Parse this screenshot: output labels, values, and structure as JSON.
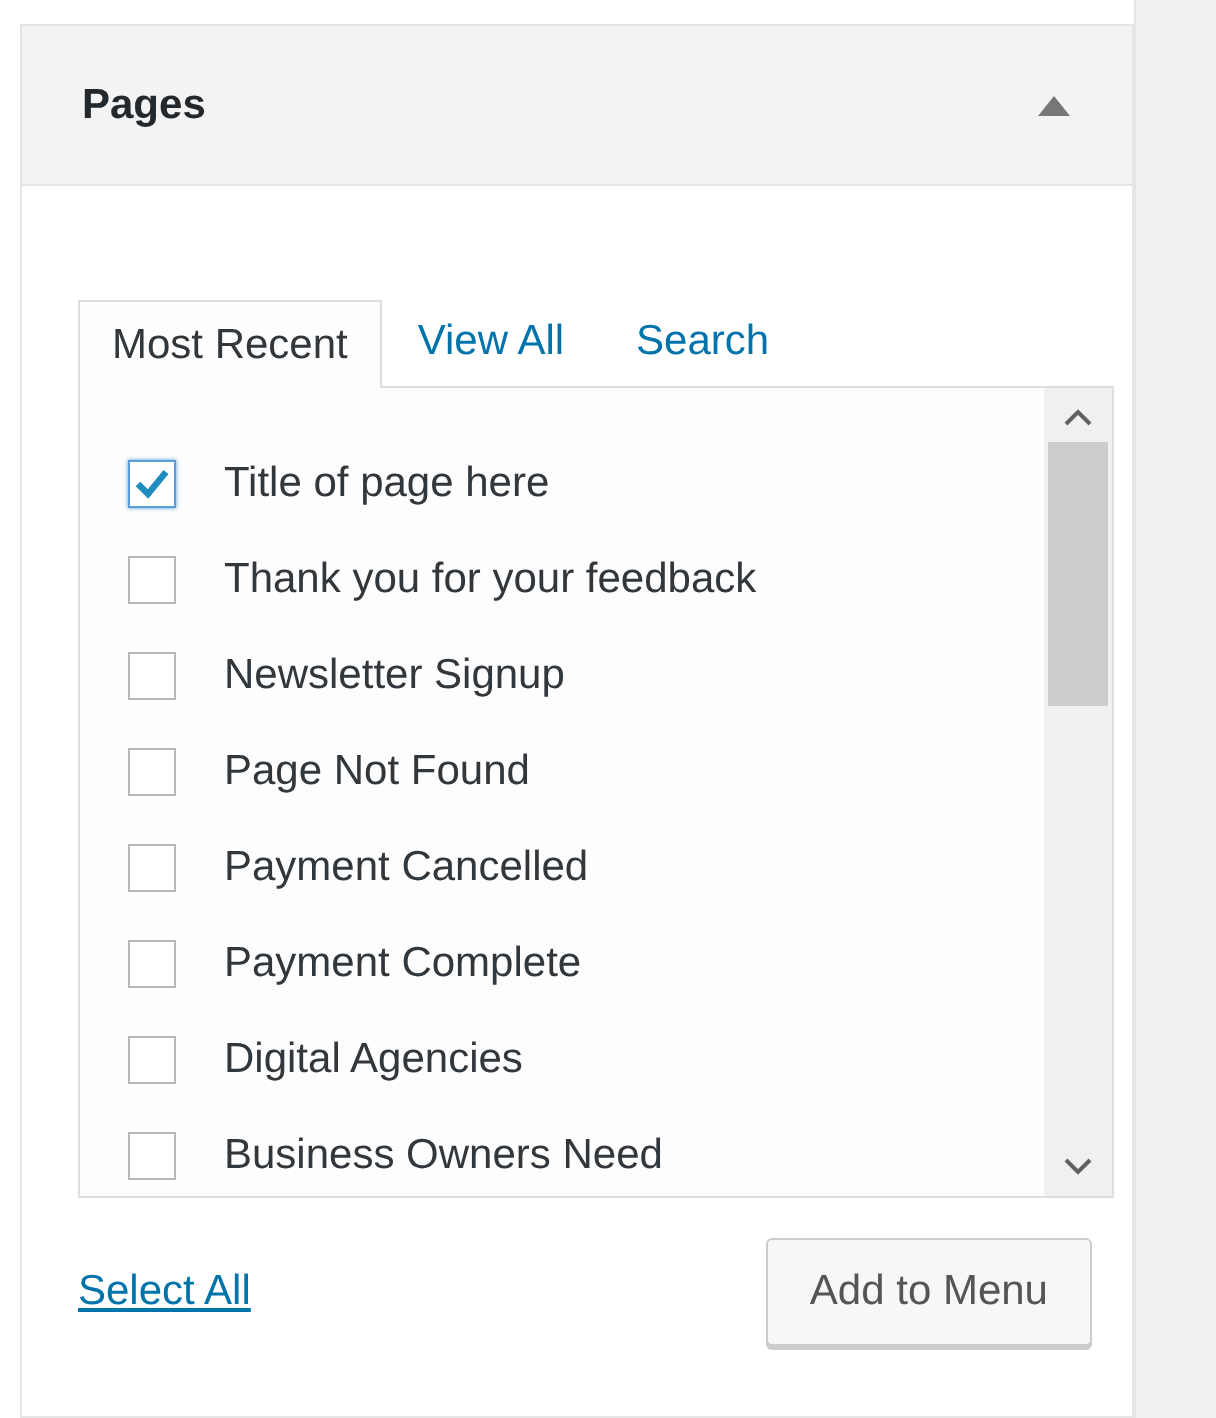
{
  "panel": {
    "title": "Pages",
    "expanded": true
  },
  "tabs": [
    {
      "label": "Most Recent",
      "selected": true
    },
    {
      "label": "View All",
      "selected": false
    },
    {
      "label": "Search",
      "selected": false
    }
  ],
  "pages": [
    {
      "label": "Title of page here",
      "checked": true
    },
    {
      "label": "Thank you for your feedback",
      "checked": false
    },
    {
      "label": "Newsletter Signup",
      "checked": false
    },
    {
      "label": "Page Not Found",
      "checked": false
    },
    {
      "label": "Payment Cancelled",
      "checked": false
    },
    {
      "label": "Payment Complete",
      "checked": false
    },
    {
      "label": "Digital Agencies",
      "checked": false
    },
    {
      "label": "Business Owners Need",
      "checked": false
    }
  ],
  "select_all": "Select All",
  "add_button": "Add to Menu"
}
